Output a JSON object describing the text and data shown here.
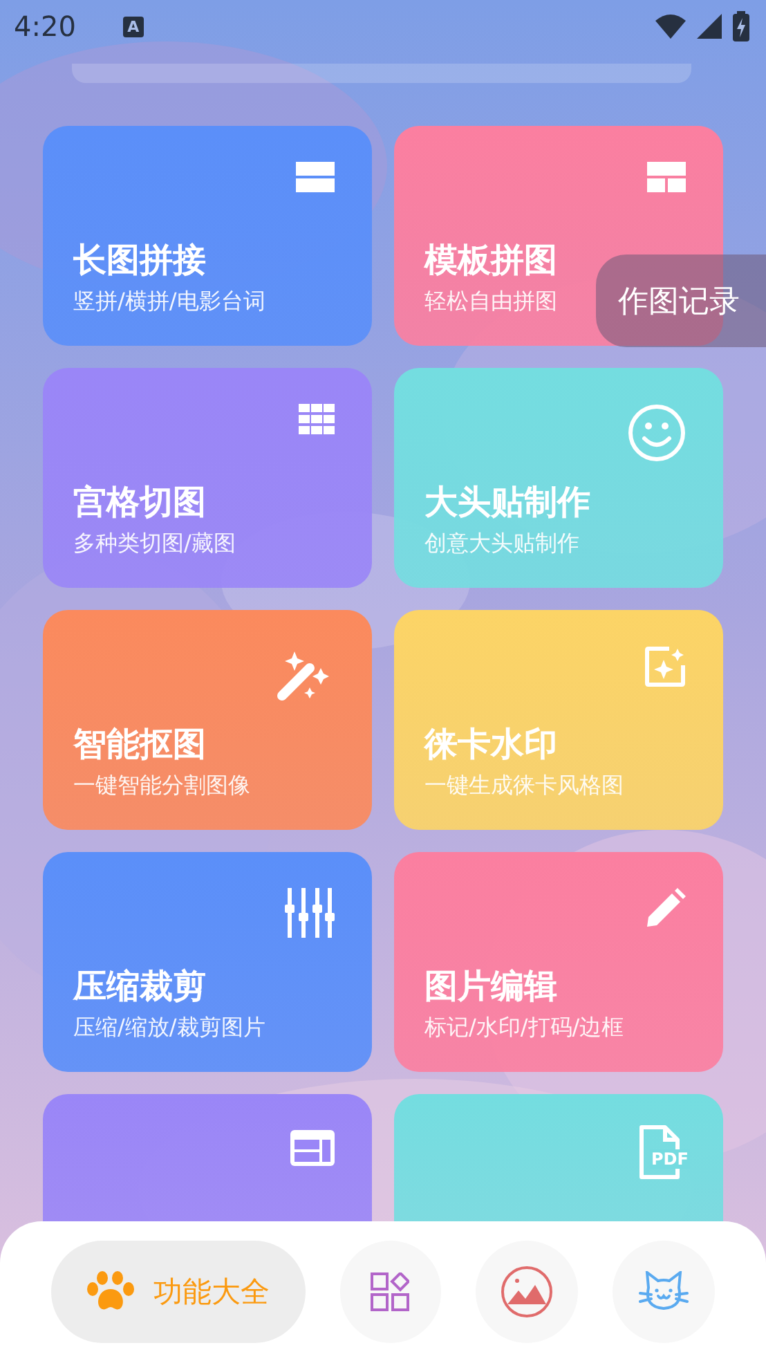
{
  "status_bar": {
    "time": "4:20",
    "input_indicator": "A"
  },
  "cards": [
    {
      "title": "长图拼接",
      "subtitle": "竖拼/横拼/电影台词",
      "kind": "rows",
      "color": "#5b8ff9"
    },
    {
      "title": "模板拼图",
      "subtitle": "轻松自由拼图",
      "kind": "template",
      "color": "#fb7fa0"
    },
    {
      "title": "宫格切图",
      "subtitle": "多种类切图/藏图",
      "kind": "grid",
      "color": "#9a86f7"
    },
    {
      "title": "大头贴制作",
      "subtitle": "创意大头贴制作",
      "kind": "smile",
      "color": "#74dde0"
    },
    {
      "title": "智能抠图",
      "subtitle": "一键智能分割图像",
      "kind": "wand",
      "color": "#fb8a5d"
    },
    {
      "title": "徕卡水印",
      "subtitle": "一键生成徕卡风格图",
      "kind": "sparkle",
      "color": "#fcd466"
    },
    {
      "title": "压缩裁剪",
      "subtitle": "压缩/缩放/裁剪图片",
      "kind": "sliders",
      "color": "#5b8ff9"
    },
    {
      "title": "图片编辑",
      "subtitle": "标记/水印/打码/边框",
      "kind": "pencil",
      "color": "#fb7fa0"
    },
    {
      "kind": "window",
      "color": "#9a86f7"
    },
    {
      "kind": "pdf",
      "icon_text": "PDF",
      "color": "#74dde0"
    }
  ],
  "history_button": "作图记录",
  "bottom_nav": [
    {
      "kind": "paw",
      "label": "功能大全",
      "selected": true
    },
    {
      "kind": "apps",
      "selected": false
    },
    {
      "kind": "picture",
      "selected": false
    },
    {
      "kind": "cat",
      "selected": false
    }
  ]
}
